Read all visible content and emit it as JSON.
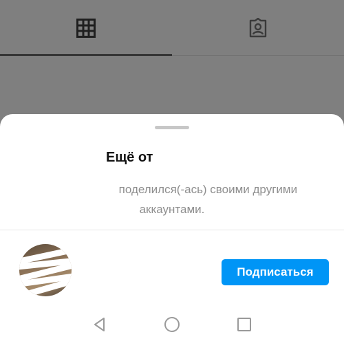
{
  "profile_tabs": [
    {
      "icon": "grid-icon",
      "active": true
    },
    {
      "icon": "tagged-person-icon",
      "active": false
    }
  ],
  "sheet": {
    "title": "Ещё от",
    "description_line1": "поделился(-ась) своими другими",
    "description_line2": "аккаунтами.",
    "account": {
      "follow_label": "Подписаться"
    }
  },
  "system_nav": {
    "back_icon": "back-triangle-icon",
    "home_icon": "home-circle-icon",
    "recents_icon": "recents-square-icon"
  },
  "colors": {
    "accent": "#0095f6",
    "overlay": "#7f7f7f",
    "secondary_text": "#8e8e8e"
  }
}
